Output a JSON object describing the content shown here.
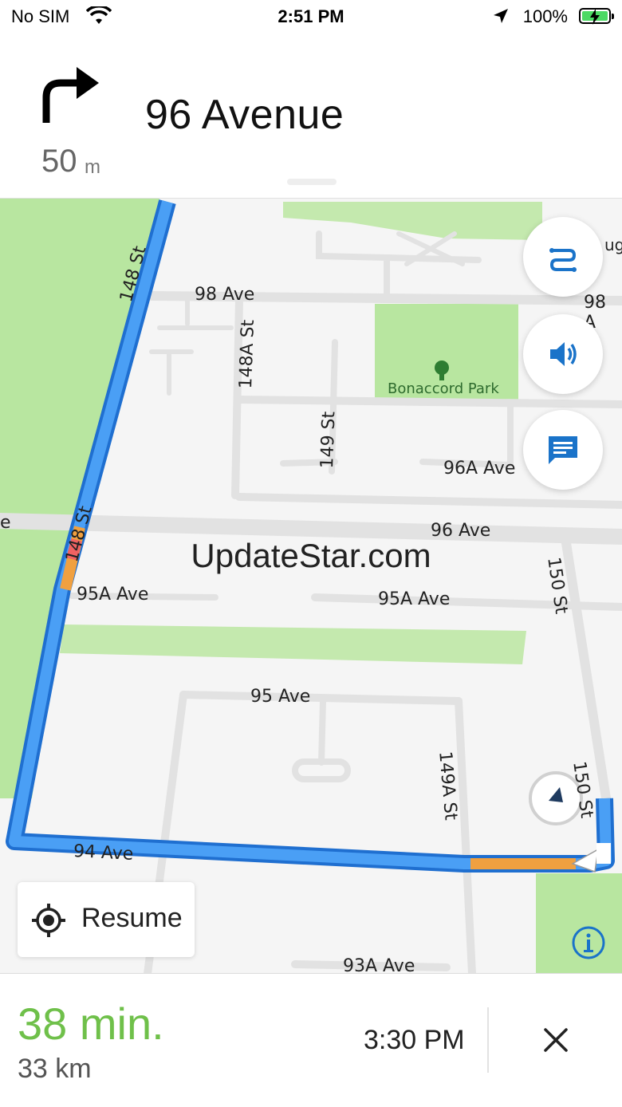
{
  "status_bar": {
    "carrier": "No SIM",
    "time": "2:51 PM",
    "battery_percent": "100%"
  },
  "nav_header": {
    "distance_value": "50",
    "distance_unit": "m",
    "street": "96 Avenue"
  },
  "map": {
    "labels": {
      "st_148_top": "148 St",
      "st_148_mid": "148 St",
      "ave_98": "98 Ave",
      "ave_98_right": "98 A",
      "st_148a": "148A St",
      "park": "Bonaccord Park",
      "st_149": "149 St",
      "ave_96a": "96A Ave",
      "ave_96": "96 Ave",
      "st_150_top": "150 St",
      "st_150_bottom": "150 St",
      "ave_95a_left": "95A Ave",
      "ave_95a_right": "95A Ave",
      "ave_95": "95 Ave",
      "st_149a": "149A St",
      "ave_94": "94 Ave",
      "ave_93a": "93A Ave",
      "edge_e": "e",
      "edge_ug": "ug"
    },
    "colors": {
      "route": "#4a9ff5",
      "route_outline": "#1f6fd0",
      "traffic_slow": "#f0a040",
      "traffic_jam": "#f06262",
      "park": "#b8e6a0",
      "road": "#e2e2e2",
      "accent_blue": "#1a73c9"
    },
    "watermark": "UpdateStar.com"
  },
  "controls": {
    "routes_icon": "route-options-icon",
    "sound_icon": "speaker-icon",
    "report_icon": "message-icon",
    "resume_label": "Resume",
    "info_icon": "info-icon"
  },
  "trip": {
    "eta_minutes": "38 min.",
    "distance_remaining": "33 km",
    "arrival_time": "3:30 PM"
  }
}
